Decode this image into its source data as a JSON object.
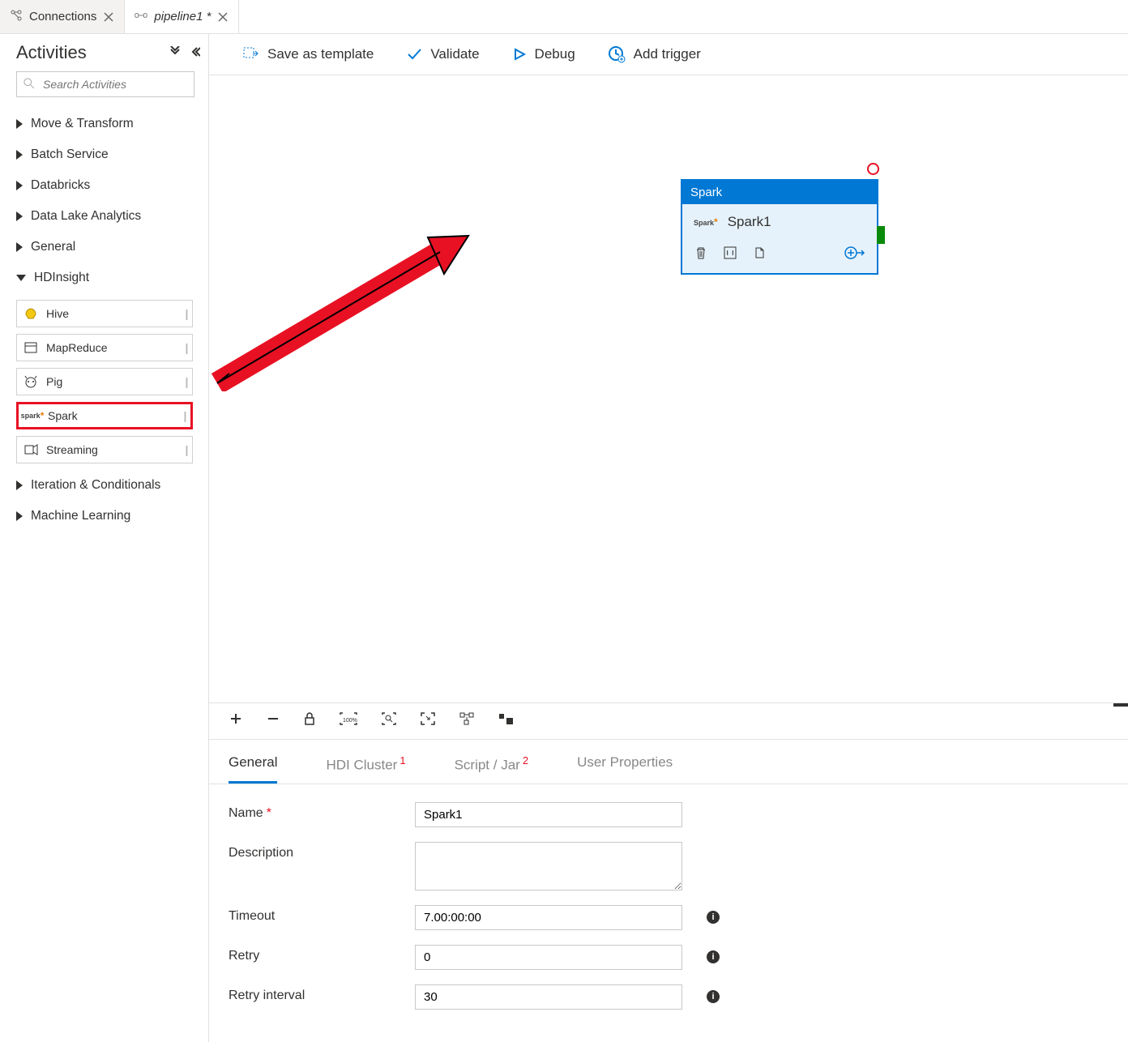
{
  "tabs": {
    "connections": {
      "label": "Connections"
    },
    "pipeline": {
      "label": "pipeline1 *"
    }
  },
  "sidebar": {
    "title": "Activities",
    "search_placeholder": "Search Activities",
    "categories": {
      "move": "Move & Transform",
      "batch": "Batch Service",
      "databricks": "Databricks",
      "dla": "Data Lake Analytics",
      "general": "General",
      "hdi": "HDInsight",
      "iter": "Iteration & Conditionals",
      "ml": "Machine Learning"
    },
    "hdi_items": {
      "hive": "Hive",
      "mapreduce": "MapReduce",
      "pig": "Pig",
      "spark": "Spark",
      "streaming": "Streaming"
    }
  },
  "toolbar": {
    "save": "Save as template",
    "validate": "Validate",
    "debug": "Debug",
    "trigger": "Add trigger"
  },
  "node": {
    "type": "Spark",
    "name": "Spark1"
  },
  "prop_tabs": {
    "general": "General",
    "hdi": "HDI Cluster",
    "script": "Script / Jar",
    "user": "User Properties",
    "hdi_badge": "1",
    "script_badge": "2"
  },
  "props": {
    "name_label": "Name",
    "name_value": "Spark1",
    "desc_label": "Description",
    "desc_value": "",
    "timeout_label": "Timeout",
    "timeout_value": "7.00:00:00",
    "retry_label": "Retry",
    "retry_value": "0",
    "retryint_label": "Retry interval",
    "retryint_value": "30"
  }
}
